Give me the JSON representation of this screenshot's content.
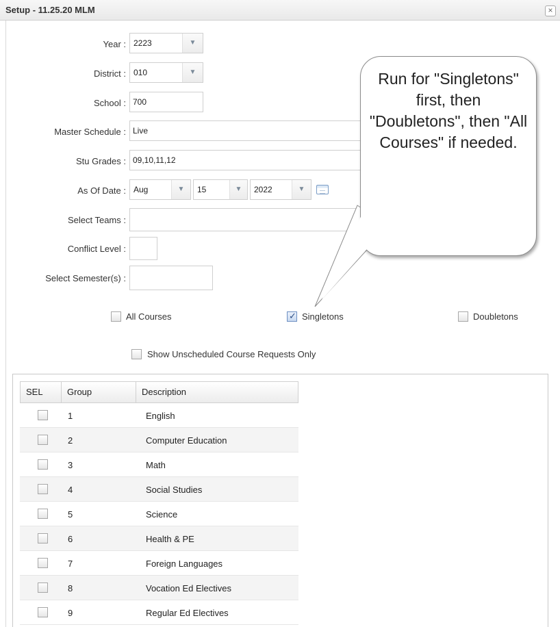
{
  "window": {
    "title": "Setup - 11.25.20 MLM",
    "close_label": "×"
  },
  "form": {
    "year": {
      "label": "Year :",
      "value": "2223"
    },
    "district": {
      "label": "District :",
      "value": "010"
    },
    "school": {
      "label": "School :",
      "value": "700"
    },
    "master_schedule": {
      "label": "Master Schedule :",
      "value": "Live"
    },
    "stu_grades": {
      "label": "Stu Grades :",
      "value": "09,10,11,12"
    },
    "as_of_date": {
      "label": "As Of Date :",
      "month": "Aug",
      "day": "15",
      "year": "2022"
    },
    "select_teams": {
      "label": "Select Teams :",
      "value": ""
    },
    "conflict_level": {
      "label": "Conflict Level :",
      "value": ""
    },
    "select_semesters": {
      "label": "Select Semester(s) :",
      "value": ""
    }
  },
  "options": {
    "all_courses": {
      "label": "All Courses",
      "checked": false
    },
    "singletons": {
      "label": "Singletons",
      "checked": true
    },
    "doubletons": {
      "label": "Doubletons",
      "checked": false
    },
    "show_unscheduled": {
      "label": "Show Unscheduled Course Requests Only",
      "checked": false
    }
  },
  "table": {
    "columns": [
      "SEL",
      "Group",
      "Description"
    ],
    "rows": [
      {
        "group": "1",
        "description": "English"
      },
      {
        "group": "2",
        "description": "Computer Education"
      },
      {
        "group": "3",
        "description": "Math"
      },
      {
        "group": "4",
        "description": "Social Studies"
      },
      {
        "group": "5",
        "description": "Science"
      },
      {
        "group": "6",
        "description": "Health & PE"
      },
      {
        "group": "7",
        "description": "Foreign Languages"
      },
      {
        "group": "8",
        "description": "Vocation Ed Electives"
      },
      {
        "group": "9",
        "description": "Regular Ed Electives"
      }
    ]
  },
  "callout": {
    "text": "Run for \"Singletons\" first, then \"Doubletons\", then \"All Courses\" if needed."
  },
  "icons": {
    "dropdown": "chevron-down-icon",
    "calendar": "calendar-icon",
    "close": "close-icon",
    "check": "check-icon"
  }
}
